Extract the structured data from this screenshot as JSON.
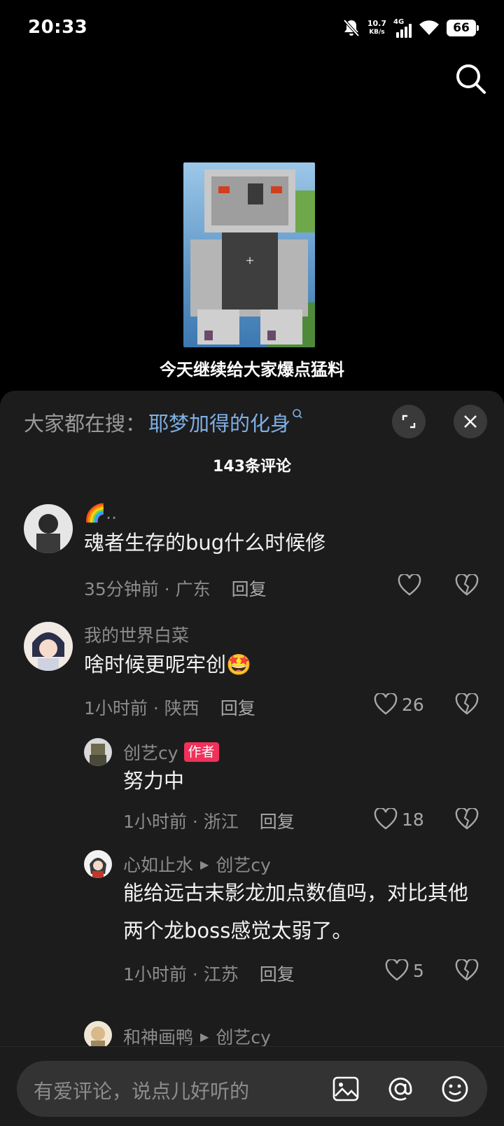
{
  "status_bar": {
    "time": "20:33",
    "net_speed_value": "10.7",
    "net_speed_unit": "KB/s",
    "network_type": "4G",
    "battery": "66",
    "icons": [
      "bell-off-icon",
      "signal-icon",
      "wifi-icon",
      "battery-icon"
    ]
  },
  "video": {
    "caption": "今天继续给大家爆点猛料"
  },
  "panel": {
    "hot_search_label": "大家都在搜：",
    "hot_search_term": "耶梦加得的化身",
    "comment_count": "143条评论"
  },
  "comments": [
    {
      "name": "🌈..",
      "text": "魂者生存的bug什么时候修",
      "meta": "35分钟前 · 广东",
      "reply_label": "回复",
      "likes": ""
    },
    {
      "name": "我的世界白菜",
      "text": "啥时候更呢牢创🤩",
      "meta": "1小时前 · 陕西",
      "reply_label": "回复",
      "likes": "26"
    },
    {
      "name": "创艺cy",
      "author_tag": "作者",
      "text": "努力中",
      "meta": "1小时前 · 浙江",
      "reply_label": "回复",
      "likes": "18"
    },
    {
      "name": "心如止水",
      "reply_to": "创艺cy",
      "text_line1": "能给远古末影龙加点数值吗，对比其他",
      "text_line2": "两个龙boss感觉太弱了。",
      "meta": "1小时前 · 江苏",
      "reply_label": "回复",
      "likes": "5"
    },
    {
      "name": "和神画鸭",
      "reply_to": "创艺cy"
    }
  ],
  "input": {
    "placeholder": "有爱评论，说点儿好听的"
  }
}
